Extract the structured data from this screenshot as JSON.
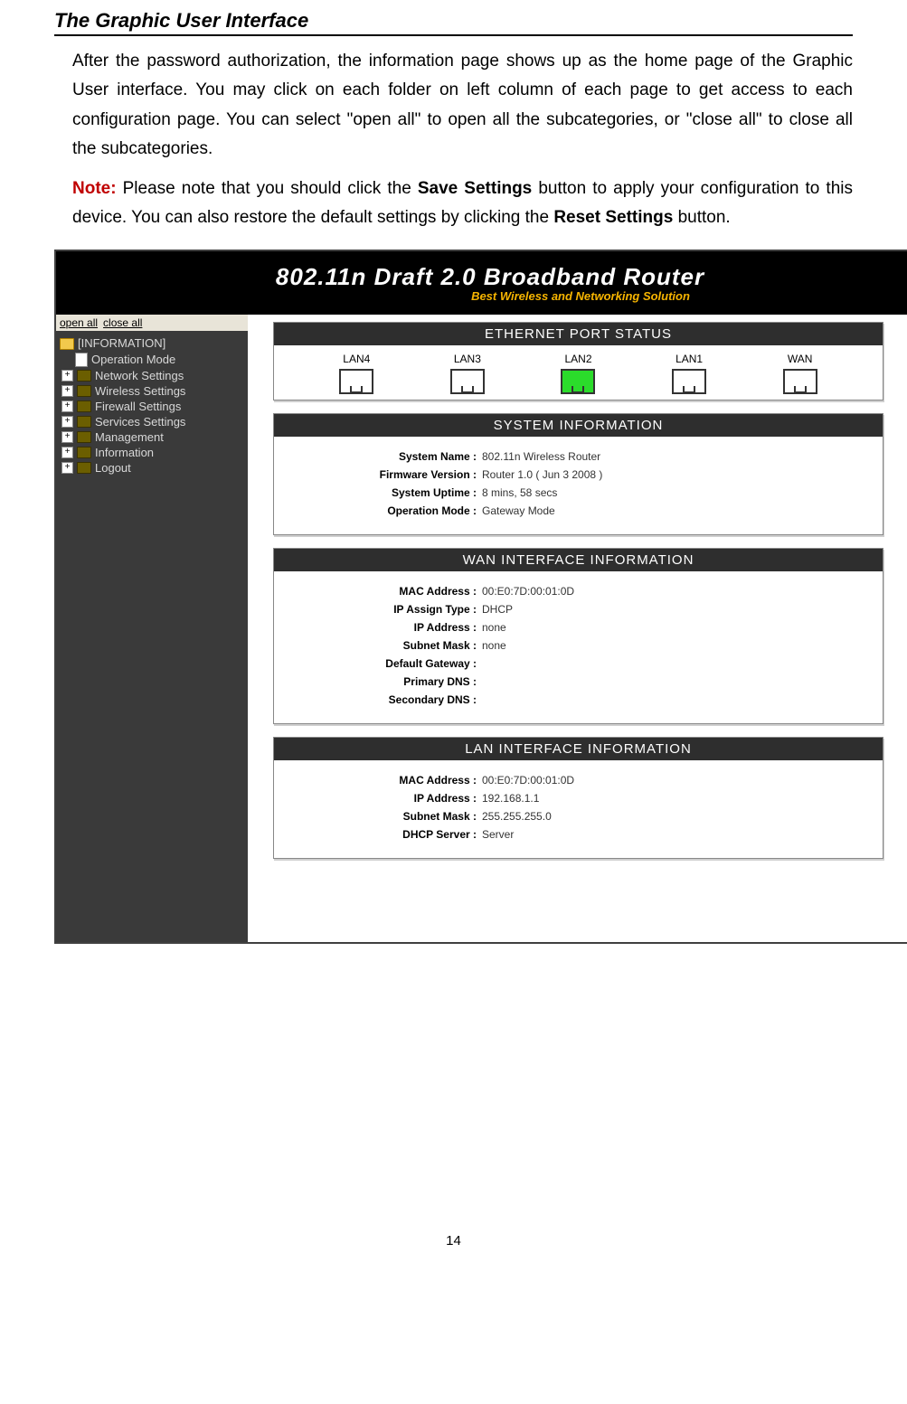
{
  "doc": {
    "section_title": "The Graphic User Interface",
    "para1": "After the password authorization, the information page shows up as the home page of the Graphic User interface. You may click on each folder on left column of each page to get access to each configuration page. You can select \"open all\" to open all the subcategories, or \"close all\" to close all the subcategories.",
    "note_label": "Note:",
    "para2_a": " Please note that you should click the ",
    "save_btn": "Save Settings",
    "para2_b": " button to apply your configuration to this device. You can also restore the default settings by clicking the ",
    "reset_btn": "Reset Settings",
    "para2_c": " button.",
    "page_number": "14"
  },
  "router": {
    "title": "802.11n Draft 2.0  Broadband Router",
    "subtitle": "Best Wireless and Networking Solution",
    "open_all": "open all",
    "close_all": "close all",
    "tree_header": "[INFORMATION]",
    "tree": [
      {
        "label": "Operation Mode",
        "expandable": false,
        "doc": true
      },
      {
        "label": "Network Settings",
        "expandable": true
      },
      {
        "label": "Wireless Settings",
        "expandable": true
      },
      {
        "label": "Firewall Settings",
        "expandable": true
      },
      {
        "label": "Services Settings",
        "expandable": true
      },
      {
        "label": "Management",
        "expandable": true
      },
      {
        "label": "Information",
        "expandable": true
      },
      {
        "label": "Logout",
        "expandable": true
      }
    ],
    "panels": {
      "port_status": {
        "title": "ETHERNET PORT STATUS",
        "ports": [
          {
            "name": "LAN4",
            "active": false
          },
          {
            "name": "LAN3",
            "active": false
          },
          {
            "name": "LAN2",
            "active": true
          },
          {
            "name": "LAN1",
            "active": false
          },
          {
            "name": "WAN",
            "active": false
          }
        ]
      },
      "system": {
        "title": "SYSTEM INFORMATION",
        "rows": [
          {
            "k": "System Name :",
            "v": "802.11n Wireless Router"
          },
          {
            "k": "Firmware Version :",
            "v": "Router 1.0 ( Jun 3 2008 )"
          },
          {
            "k": "System Uptime :",
            "v": "8 mins, 58 secs"
          },
          {
            "k": "Operation Mode :",
            "v": "Gateway Mode"
          }
        ]
      },
      "wan": {
        "title": "WAN INTERFACE INFORMATION",
        "rows": [
          {
            "k": "MAC Address :",
            "v": "00:E0:7D:00:01:0D"
          },
          {
            "k": "IP Assign Type :",
            "v": "DHCP"
          },
          {
            "k": "IP Address :",
            "v": "none"
          },
          {
            "k": "Subnet Mask :",
            "v": "none"
          },
          {
            "k": "Default Gateway :",
            "v": ""
          },
          {
            "k": "Primary DNS :",
            "v": ""
          },
          {
            "k": "Secondary DNS :",
            "v": ""
          }
        ]
      },
      "lan": {
        "title": "LAN INTERFACE INFORMATION",
        "rows": [
          {
            "k": "MAC Address :",
            "v": "00:E0:7D:00:01:0D"
          },
          {
            "k": "IP Address :",
            "v": "192.168.1.1"
          },
          {
            "k": "Subnet Mask :",
            "v": "255.255.255.0"
          },
          {
            "k": "DHCP Server :",
            "v": "Server"
          }
        ]
      }
    }
  }
}
